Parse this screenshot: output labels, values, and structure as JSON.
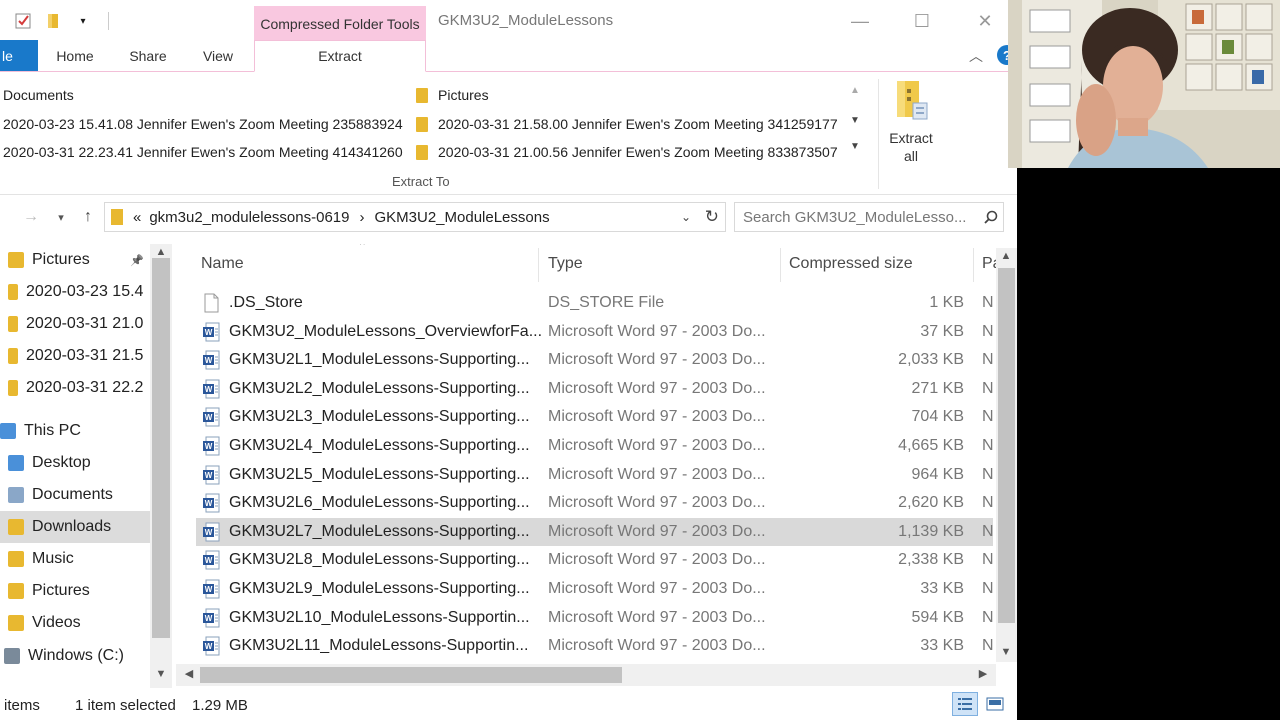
{
  "window": {
    "title": "GKM3U2_ModuleLessons",
    "context_tab_group": "Compressed Folder Tools",
    "controls": {
      "minimize": "—",
      "maximize": "☐",
      "close": "✕"
    }
  },
  "ribbon_tabs": [
    {
      "label": "le"
    },
    {
      "label": "Home"
    },
    {
      "label": "Share"
    },
    {
      "label": "View"
    },
    {
      "label": "Extract"
    }
  ],
  "ribbon": {
    "extract_to_gallery": [
      {
        "label": "Documents",
        "has_folder_icon": false
      },
      {
        "label": "Pictures",
        "has_folder_icon": true
      },
      {
        "label": "2020-03-23 15.41.08 Jennifer Ewen's Zoom Meeting 235883924",
        "has_folder_icon": false
      },
      {
        "label": "2020-03-31 21.58.00 Jennifer Ewen's Zoom Meeting 341259177",
        "has_folder_icon": true
      },
      {
        "label": "2020-03-31 22.23.41 Jennifer Ewen's Zoom Meeting 414341260",
        "has_folder_icon": false
      },
      {
        "label": "2020-03-31 21.00.56 Jennifer Ewen's Zoom Meeting 833873507",
        "has_folder_icon": true
      }
    ],
    "group_label": "Extract To",
    "extract_all_label": "Extract all"
  },
  "address": {
    "overflow": "«",
    "crumbs": [
      "gkm3u2_modulelessons-0619",
      "GKM3U2_ModuleLessons"
    ],
    "separator": "›",
    "search_placeholder": "Search GKM3U2_ModuleLesso..."
  },
  "nav_pane": [
    {
      "label": "Pictures",
      "icon": "pictures-folder",
      "pinned": true
    },
    {
      "label": "2020-03-23 15.4",
      "icon": "folder"
    },
    {
      "label": "2020-03-31 21.0",
      "icon": "folder"
    },
    {
      "label": "2020-03-31 21.5",
      "icon": "folder"
    },
    {
      "label": "2020-03-31 22.2",
      "icon": "folder"
    },
    {
      "label": "This PC",
      "icon": "computer"
    },
    {
      "label": "Desktop",
      "icon": "desktop-folder"
    },
    {
      "label": "Documents",
      "icon": "documents-folder"
    },
    {
      "label": "Downloads",
      "icon": "downloads-folder",
      "selected": true
    },
    {
      "label": "Music",
      "icon": "music-folder"
    },
    {
      "label": "Pictures",
      "icon": "pictures-folder"
    },
    {
      "label": "Videos",
      "icon": "videos-folder"
    },
    {
      "label": "Windows (C:)",
      "icon": "drive"
    }
  ],
  "file_list": {
    "columns": [
      "Name",
      "Type",
      "Compressed size",
      "Pa"
    ],
    "rows": [
      {
        "name": ".DS_Store",
        "type": "DS_STORE File",
        "size": "1 KB",
        "extra": "N",
        "icon": "blank-file"
      },
      {
        "name": "GKM3U2_ModuleLessons_OverviewforFa...",
        "type": "Microsoft Word 97 - 2003 Do...",
        "size": "37 KB",
        "extra": "N",
        "icon": "word-doc"
      },
      {
        "name": "GKM3U2L1_ModuleLessons-Supporting...",
        "type": "Microsoft Word 97 - 2003 Do...",
        "size": "2,033 KB",
        "extra": "N",
        "icon": "word-doc"
      },
      {
        "name": "GKM3U2L2_ModuleLessons-Supporting...",
        "type": "Microsoft Word 97 - 2003 Do...",
        "size": "271 KB",
        "extra": "N",
        "icon": "word-doc"
      },
      {
        "name": "GKM3U2L3_ModuleLessons-Supporting...",
        "type": "Microsoft Word 97 - 2003 Do...",
        "size": "704 KB",
        "extra": "N",
        "icon": "word-doc"
      },
      {
        "name": "GKM3U2L4_ModuleLessons-Supporting...",
        "type": "Microsoft Word 97 - 2003 Do...",
        "size": "4,665 KB",
        "extra": "N",
        "icon": "word-doc"
      },
      {
        "name": "GKM3U2L5_ModuleLessons-Supporting...",
        "type": "Microsoft Word 97 - 2003 Do...",
        "size": "964 KB",
        "extra": "N",
        "icon": "word-doc"
      },
      {
        "name": "GKM3U2L6_ModuleLessons-Supporting...",
        "type": "Microsoft Word 97 - 2003 Do...",
        "size": "2,620 KB",
        "extra": "N",
        "icon": "word-doc"
      },
      {
        "name": "GKM3U2L7_ModuleLessons-Supporting...",
        "type": "Microsoft Word 97 - 2003 Do...",
        "size": "1,139 KB",
        "extra": "N",
        "icon": "word-doc",
        "selected": true
      },
      {
        "name": "GKM3U2L8_ModuleLessons-Supporting...",
        "type": "Microsoft Word 97 - 2003 Do...",
        "size": "2,338 KB",
        "extra": "N",
        "icon": "word-doc"
      },
      {
        "name": "GKM3U2L9_ModuleLessons-Supporting...",
        "type": "Microsoft Word 97 - 2003 Do...",
        "size": "33 KB",
        "extra": "N",
        "icon": "word-doc"
      },
      {
        "name": "GKM3U2L10_ModuleLessons-Supportin...",
        "type": "Microsoft Word 97 - 2003 Do...",
        "size": "594 KB",
        "extra": "N",
        "icon": "word-doc"
      },
      {
        "name": "GKM3U2L11_ModuleLessons-Supportin...",
        "type": "Microsoft Word 97 - 2003 Do...",
        "size": "33 KB",
        "extra": "N",
        "icon": "word-doc"
      }
    ]
  },
  "status_bar": {
    "items_count": "items",
    "selection": "1 item selected",
    "selection_size": "1.29 MB"
  },
  "colors": {
    "file_tab": "#1979ca",
    "context_tab": "#f9c8e0",
    "folder": "#e8b830",
    "selected_row": "#d9d9d9"
  }
}
